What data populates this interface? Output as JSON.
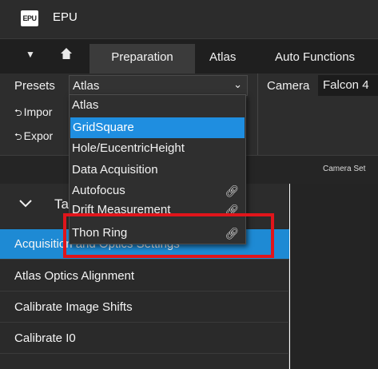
{
  "app": {
    "logo": "EPU",
    "title": "EPU"
  },
  "tabs": {
    "menu_icon": "caret-down-icon",
    "home_icon": "home-icon",
    "items": [
      {
        "label": "Preparation",
        "active": true
      },
      {
        "label": "Atlas"
      },
      {
        "label": "Auto Functions"
      }
    ]
  },
  "toolbar": {
    "presets_label": "Presets",
    "presets_value": "Atlas",
    "camera_label": "Camera",
    "camera_value": "Falcon 4",
    "import_label": "Impor",
    "export_label": "Expor",
    "camera_settings": "Camera Set"
  },
  "dropdown": {
    "options": [
      {
        "label": "Atlas"
      },
      {
        "label": "GridSquare",
        "selected": true
      },
      {
        "label": "Hole/EucentricHeight"
      },
      {
        "label": "Data Acquisition"
      },
      {
        "label": "Autofocus",
        "icon": "link-icon"
      },
      {
        "label": "Drift Measurement",
        "icon": "link-icon"
      },
      {
        "label": "Thon Ring",
        "icon": "link-icon"
      }
    ]
  },
  "task_panel": {
    "title": "Ta",
    "items": [
      {
        "label": "Acquisition and Optics Settings",
        "selected": true
      },
      {
        "label": "Atlas Optics Alignment"
      },
      {
        "label": "Calibrate Image Shifts"
      },
      {
        "label": "Calibrate I0"
      }
    ]
  },
  "colors": {
    "accent": "#1f8ee0",
    "highlight": "#e0151b",
    "background": "#2a2a2a"
  }
}
